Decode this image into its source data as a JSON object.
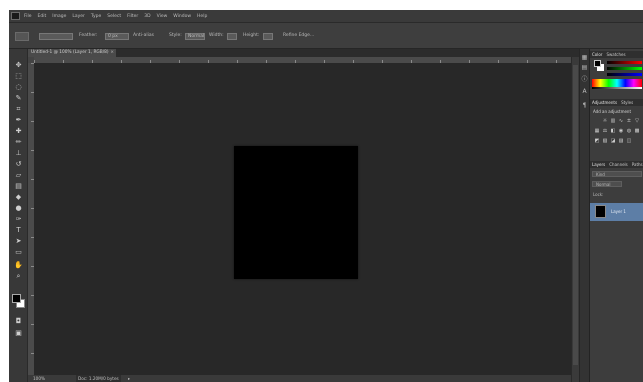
{
  "app": {
    "logo": "Ps"
  },
  "menubar": {
    "items": [
      "File",
      "Edit",
      "Image",
      "Layer",
      "Type",
      "Select",
      "Filter",
      "3D",
      "View",
      "Window",
      "Help"
    ]
  },
  "optionsbar": {
    "items": [
      "Feather:",
      "0 px",
      "Anti-alias",
      "Style:",
      "Normal",
      "Width:",
      "Height:",
      "Refine Edge..."
    ]
  },
  "document": {
    "tab_title": "Untitled-1 @ 100% (Layer 1, RGB/8)",
    "close_glyph": "×"
  },
  "toolbox": {
    "tools": [
      "move",
      "marquee",
      "lasso",
      "quick-select",
      "crop",
      "eyedropper",
      "healing",
      "brush",
      "clone-stamp",
      "history-brush",
      "eraser",
      "gradient",
      "blur",
      "dodge",
      "pen",
      "type",
      "path-select",
      "shape",
      "hand",
      "zoom"
    ],
    "foreground_color": "#000000",
    "background_color": "#ffffff"
  },
  "canvas": {
    "fill_color": "#000000"
  },
  "statusbar": {
    "zoom": "100%",
    "doc_info": "Doc: 1.20M/0 bytes",
    "arrow": "▸"
  },
  "panels": {
    "color_tabs": [
      "Color",
      "Swatches"
    ],
    "adjust_tabs": [
      "Adjustments",
      "Styles"
    ],
    "adjust_title": "Add an adjustment",
    "layer_tabs": [
      "Layers",
      "Channels",
      "Paths"
    ],
    "layer_kind": "Kind",
    "layer_mode": "Normal",
    "layer_lock": "Lock:",
    "layer_name": "Layer 1",
    "selected_color": "#5d7ea6"
  }
}
